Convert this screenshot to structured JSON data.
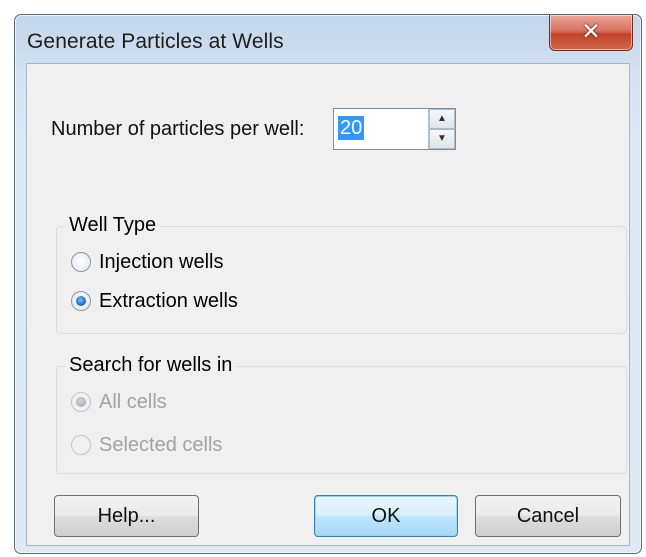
{
  "window": {
    "title": "Generate Particles at Wells",
    "close_icon": "close-icon"
  },
  "particles": {
    "label": "Number of particles per well:",
    "value": "20"
  },
  "well_type": {
    "title": "Well Type",
    "options": [
      {
        "label": "Injection wells",
        "selected": false
      },
      {
        "label": "Extraction wells",
        "selected": true
      }
    ]
  },
  "search": {
    "title": "Search for wells in",
    "enabled": false,
    "options": [
      {
        "label": "All cells",
        "selected": true
      },
      {
        "label": "Selected cells",
        "selected": false
      }
    ]
  },
  "buttons": {
    "help": "Help...",
    "ok": "OK",
    "cancel": "Cancel"
  },
  "colors": {
    "selection": "#3399ff",
    "close_button": "#c2412b",
    "default_button_border": "#3c7fb1"
  }
}
